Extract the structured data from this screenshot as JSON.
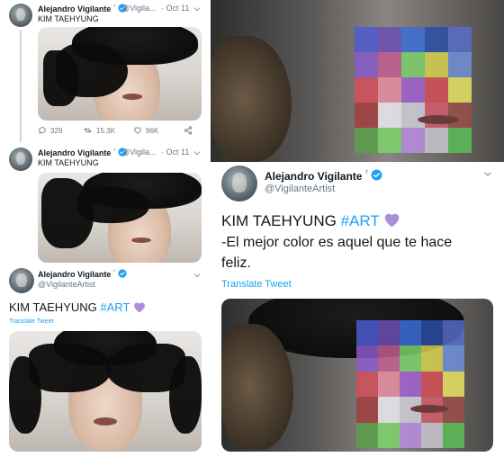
{
  "tweet1": {
    "name": "Alejandro Vigilante",
    "sup": "⁷",
    "handle": "@Vigila...",
    "date": "· Oct 11",
    "text": "KIM TAEHYUNG",
    "replies": "329",
    "retweets": "15.3K",
    "likes": "96K"
  },
  "tweet2": {
    "name": "Alejandro Vigilante",
    "sup": "⁷",
    "handle": "@Vigila...",
    "date": "· Oct 11",
    "text": "KIM TAEHYUNG"
  },
  "tweet3": {
    "name": "Alejandro Vigilante",
    "sup": "⁷",
    "handle": "@VigilanteArtist",
    "text_prefix": "KIM TAEHYUNG",
    "hashtag": "#ART",
    "translate": "Translate Tweet"
  },
  "tweet4": {
    "name": "Alejandro Vigilante",
    "sup": "⁷",
    "handle": "@VigilanteArtist",
    "text_prefix": "KIM TAEHYUNG",
    "hashtag": "#ART",
    "line2": "-El mejor color es aquel que te hace",
    "line3": "feliz.",
    "translate": "Translate Tweet"
  },
  "icons": {
    "verified": "verified-badge-icon",
    "heart": "purple-heart-icon",
    "chevron": "chevron-down-icon",
    "reply": "reply-icon",
    "retweet": "retweet-icon",
    "like": "like-icon",
    "share": "share-icon"
  },
  "colors": {
    "link": "#1da1f2",
    "verified": "#1da1f2",
    "purple_heart": "#ab8ed8",
    "secondary_text": "#657786"
  }
}
